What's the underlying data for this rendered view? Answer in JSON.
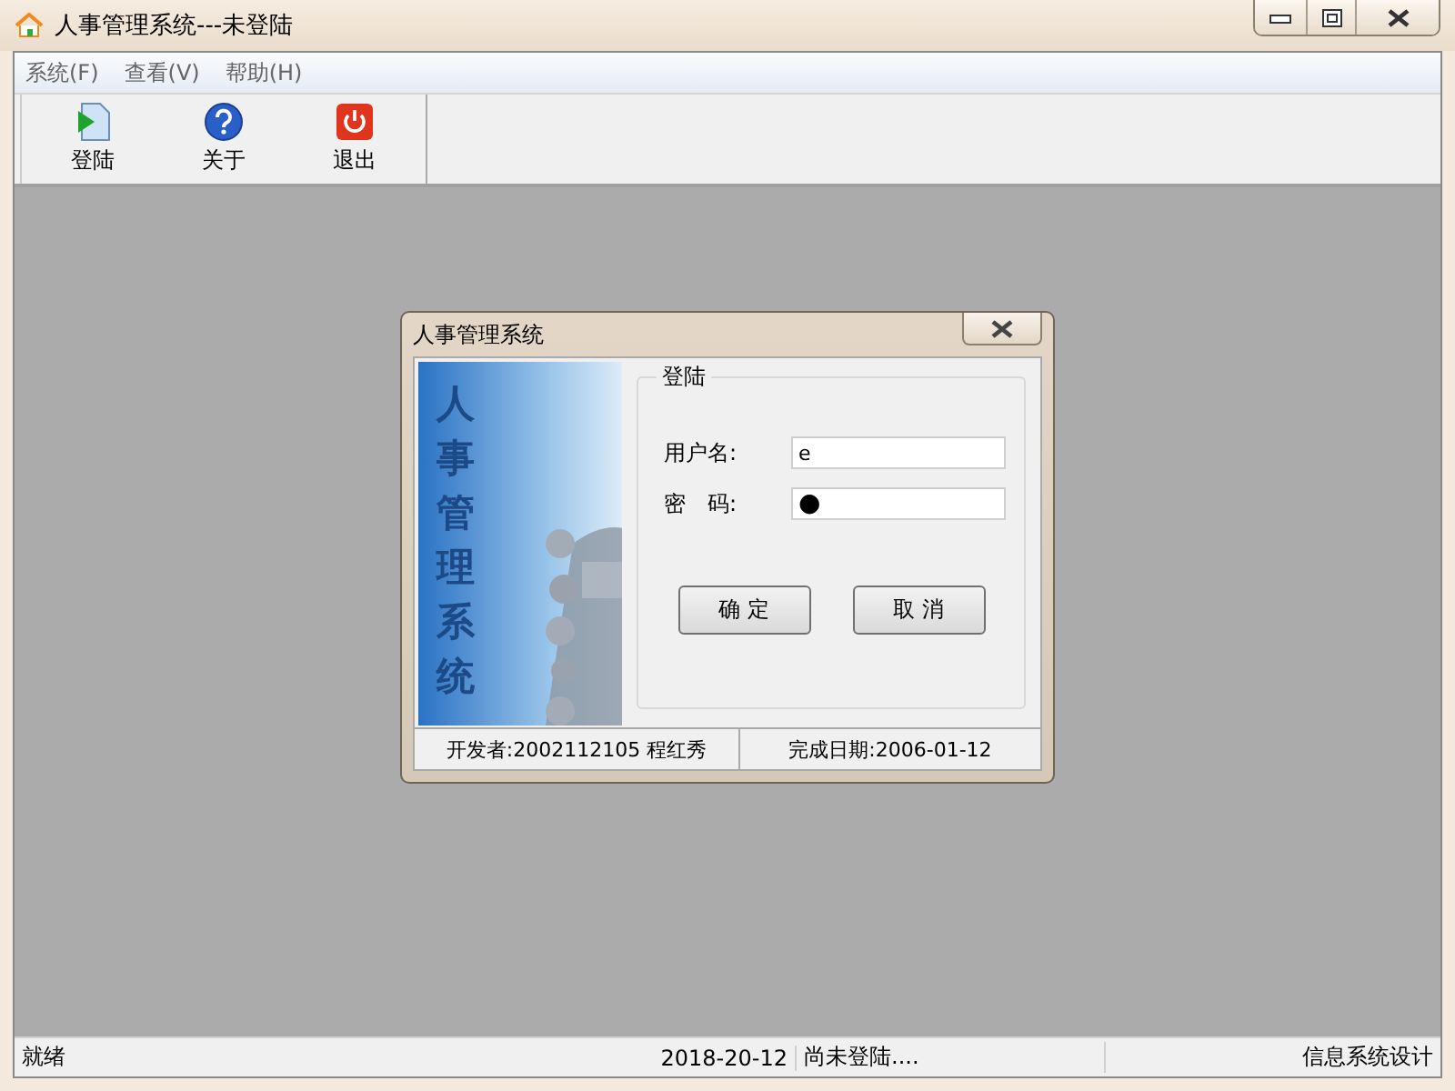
{
  "window": {
    "title": "人事管理系统---未登陆"
  },
  "menu": [
    {
      "label": "系统(F)"
    },
    {
      "label": "查看(V)"
    },
    {
      "label": "帮助(H)"
    }
  ],
  "toolbar": [
    {
      "label": "登陆",
      "kind": "login"
    },
    {
      "label": "关于",
      "kind": "help"
    },
    {
      "label": "退出",
      "kind": "exit"
    }
  ],
  "dialog": {
    "title": "人事管理系统",
    "banner_text": "人事管理系统",
    "group_title": "登陆",
    "fields": [
      {
        "label": "用户名:",
        "value": "e",
        "kind": "text"
      },
      {
        "label": "密　码:",
        "value": "●",
        "kind": "password"
      }
    ],
    "buttons": [
      "确 定",
      "取 消"
    ],
    "footer": [
      "开发者:2002112105 程红秀",
      "完成日期:2006-01-12"
    ]
  },
  "status_bar": [
    {
      "text": "就绪"
    },
    {
      "text": "2018-20-12"
    },
    {
      "text": "尚未登陆...."
    },
    {
      "text": "信息系统设计"
    }
  ]
}
